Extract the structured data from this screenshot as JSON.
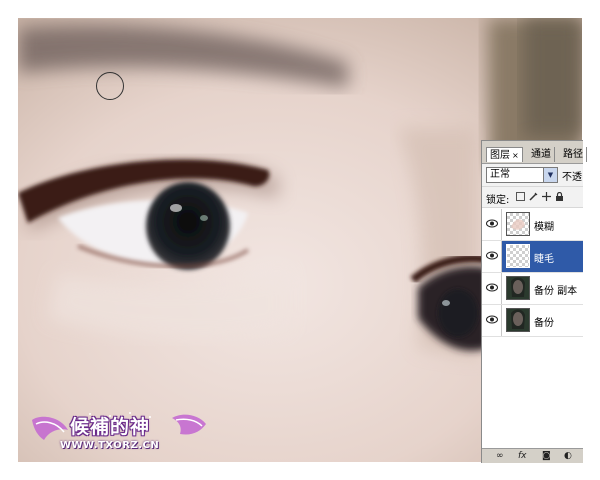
{
  "panel": {
    "tabs": [
      {
        "label": "图层",
        "close": "×"
      },
      {
        "label": "通道"
      },
      {
        "label": "路径"
      }
    ],
    "blend_mode": "正常",
    "opacity_label": "不透",
    "lock_label": "锁定:",
    "lock_icons": [
      "lock-transparent-icon",
      "lock-paint-icon",
      "lock-move-icon",
      "lock-all-icon"
    ],
    "layers": [
      {
        "name": "模糊",
        "visible": true,
        "selected": false
      },
      {
        "name": "睫毛",
        "visible": true,
        "selected": true
      },
      {
        "name": "备份 副本",
        "visible": true,
        "selected": false
      },
      {
        "name": "备份",
        "visible": true,
        "selected": false
      }
    ],
    "bottom_icons": [
      "link-layers-icon",
      "fx-icon",
      "mask-icon",
      "adjustment-icon"
    ],
    "fx_label": "fx"
  },
  "watermark": {
    "title": "候補的神",
    "url": "WWW.TXORZ.CN"
  },
  "colors": {
    "selected_layer": "#2f5aa8",
    "skin": "#e7d6cf"
  }
}
